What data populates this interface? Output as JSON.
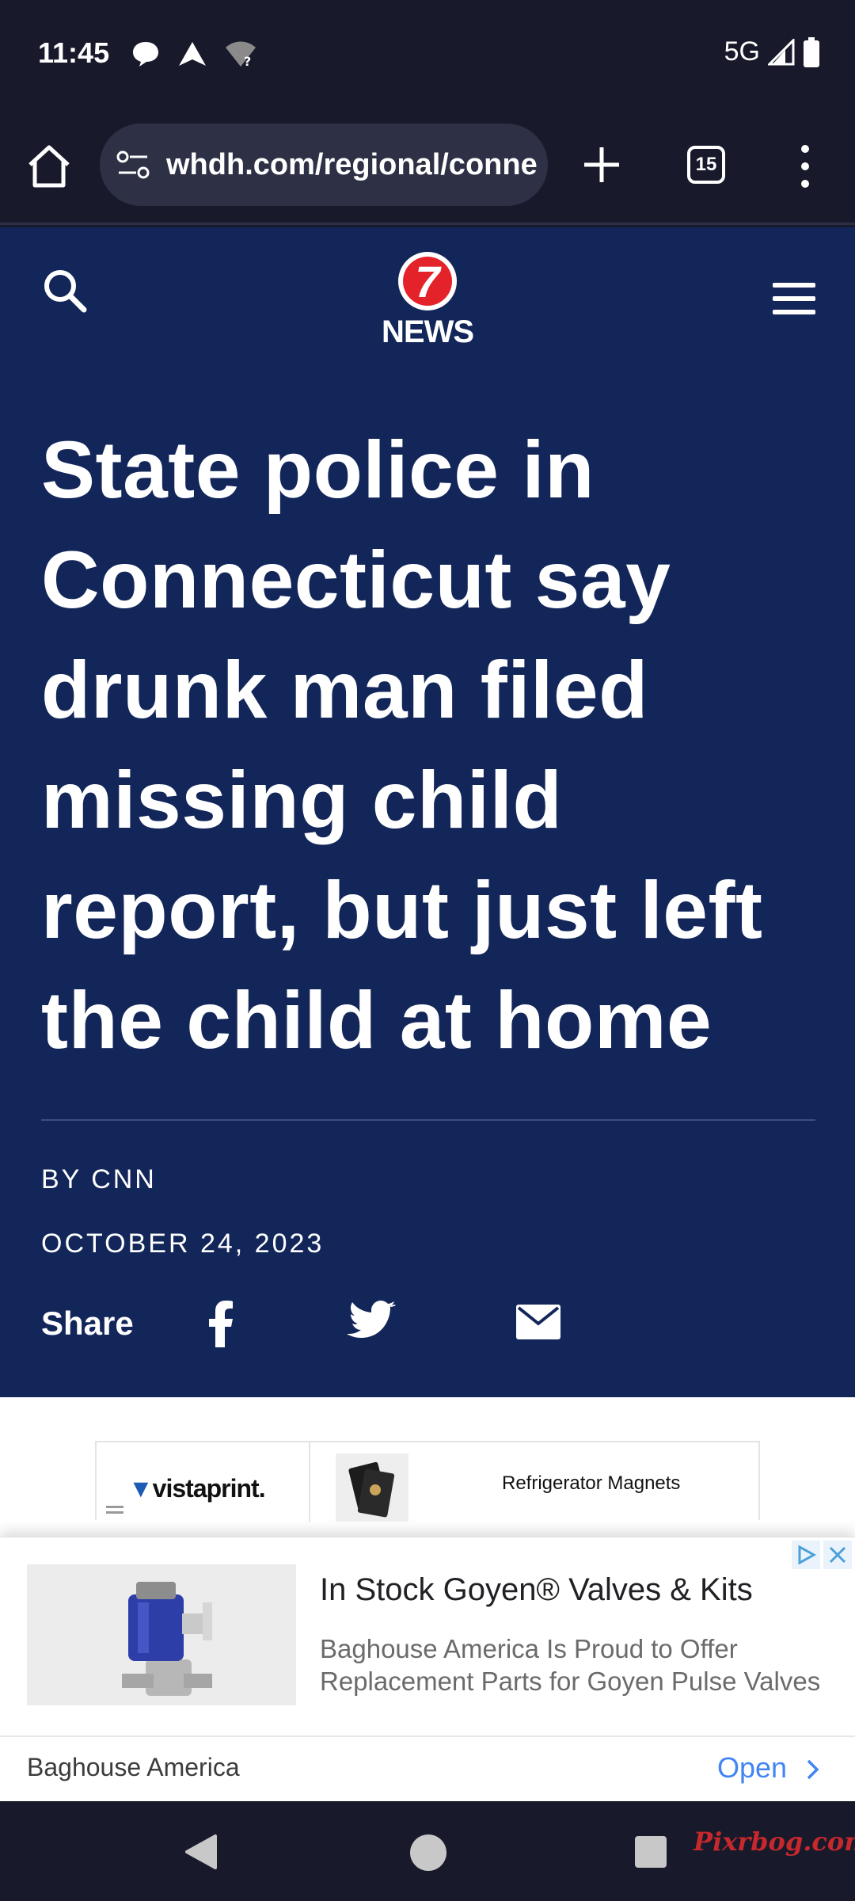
{
  "status_bar": {
    "time": "11:45",
    "network": "5G",
    "icons": [
      "chat-bubble-icon",
      "navigation-arrow-icon",
      "wifi-unknown-icon",
      "signal-icon",
      "battery-icon"
    ]
  },
  "browser": {
    "url": "whdh.com/regional/connecticut/state-police-in-connecticut-say-drunk-man-filed-missing-child-report",
    "tab_count": "15",
    "icons": [
      "home-icon",
      "site-settings-icon",
      "new-tab-plus-icon",
      "tab-switcher-icon",
      "more-vertical-icon"
    ]
  },
  "site": {
    "logo_number": "7",
    "logo_text": "NEWS",
    "brand_color": "#13265a",
    "logo_color": "#e4222a"
  },
  "article": {
    "headline": "State police in Connecticut say drunk man filed missing child report, but just left the child at home",
    "byline": "BY CNN",
    "date": "OCTOBER 24, 2023",
    "share_label": "Share",
    "share_icons": [
      "facebook-icon",
      "twitter-icon",
      "email-icon"
    ]
  },
  "top_ad": {
    "brand": "vistaprint.",
    "title": "Refrigerator Magnets"
  },
  "bottom_ad": {
    "headline": "In Stock Goyen® Valves & Kits",
    "description": "Baghouse America Is Proud to Offer Replacement Parts for Goyen Pulse Valves",
    "advertiser": "Baghouse America",
    "cta": "Open"
  },
  "watermark": "Pixrbog.com"
}
